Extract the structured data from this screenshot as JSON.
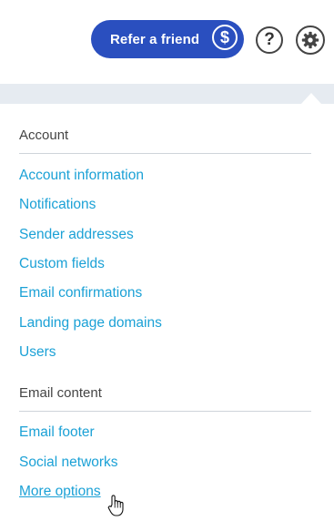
{
  "header": {
    "refer_label": "Refer a friend",
    "refer_icon": "$",
    "help_icon": "?",
    "settings_icon": "gear-icon",
    "accent_color": "#2a4fbf"
  },
  "menu": {
    "link_color": "#1ba1d6",
    "sections": [
      {
        "title": "Account",
        "items": [
          "Account information",
          "Notifications",
          "Sender addresses",
          "Custom fields",
          "Email confirmations",
          "Landing page domains",
          "Users"
        ]
      },
      {
        "title": "Email content",
        "items": [
          "Email footer",
          "Social networks",
          "More options"
        ]
      }
    ],
    "hovered_item": "More options"
  }
}
